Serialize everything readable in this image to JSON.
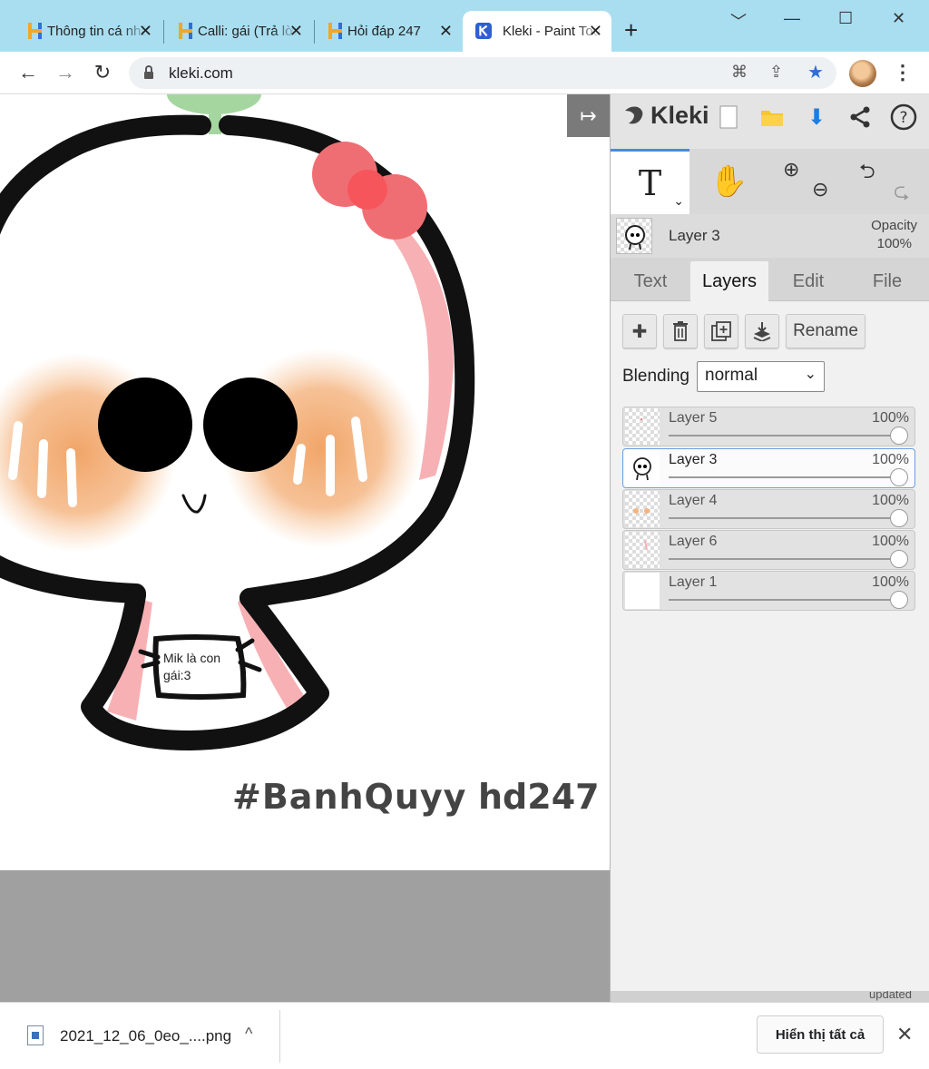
{
  "browser": {
    "tabs": [
      {
        "title": "Thông tin cá nhân",
        "icon": "hoidap-h-icon"
      },
      {
        "title": "Calli: gái (Trả lời)",
        "icon": "hoidap-h-icon"
      },
      {
        "title": "Hỏi đáp 247",
        "icon": "hoidap-h-icon"
      },
      {
        "title": "Kleki - Paint Tool",
        "icon": "kleki-icon",
        "active": true
      }
    ],
    "new_tab": "+",
    "url": "kleki.com"
  },
  "canvas": {
    "note_text": "Mik là con gái:3",
    "tag_left": "#BanhQuyy",
    "tag_right": "hd247",
    "colors": {
      "outline": "#111111",
      "blush": "#f0a060",
      "bow": "#ef6e73",
      "ear": "#f7b1b4",
      "leaf": "#a5d6a0"
    }
  },
  "panel": {
    "brand": "Kleki",
    "active_tool": "text",
    "current_layer": {
      "name": "Layer 3",
      "opacity_label": "Opacity",
      "opacity_value": "100%"
    },
    "tabs": [
      {
        "label": "Text"
      },
      {
        "label": "Layers",
        "active": true
      },
      {
        "label": "Edit"
      },
      {
        "label": "File"
      }
    ],
    "rename_label": "Rename",
    "blending_label": "Blending",
    "blending_value": "normal",
    "layers": [
      {
        "name": "Layer 5",
        "opacity": "100%",
        "opacity_fraction": 1.0
      },
      {
        "name": "Layer 3",
        "opacity": "100%",
        "opacity_fraction": 1.0,
        "selected": true
      },
      {
        "name": "Layer 4",
        "opacity": "100%",
        "opacity_fraction": 1.0
      },
      {
        "name": "Layer 6",
        "opacity": "100%",
        "opacity_fraction": 1.0
      },
      {
        "name": "Layer 1",
        "opacity": "100%",
        "opacity_fraction": 1.0
      }
    ],
    "bottom_text": "updated",
    "accent": "#4d8ad8"
  },
  "downloads": {
    "file_name": "2021_12_06_0eo_....png",
    "show_all": "Hiển thị tất cả"
  }
}
